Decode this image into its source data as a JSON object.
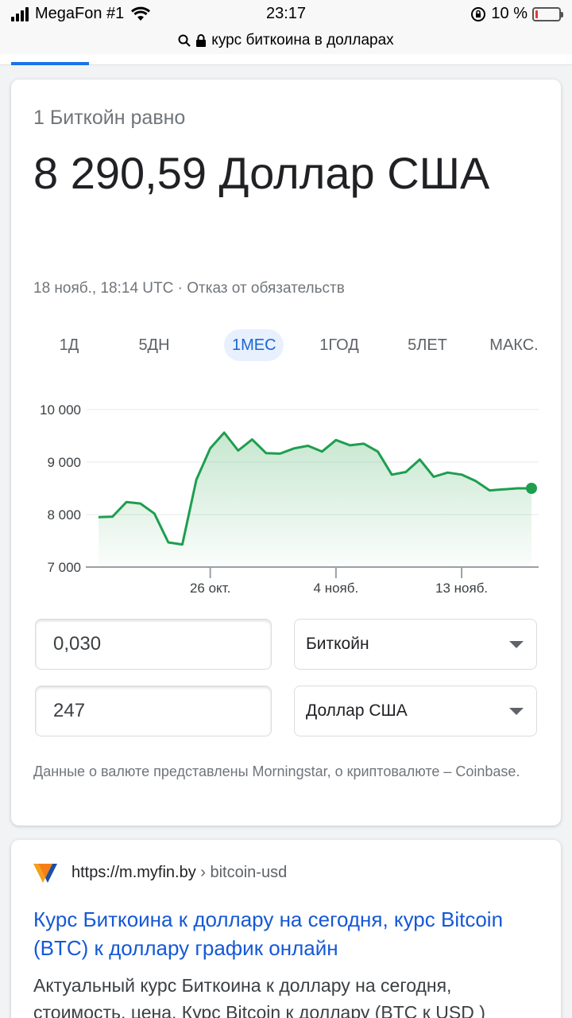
{
  "status_bar": {
    "carrier": "MegaFon #1",
    "time": "23:17",
    "battery_percent": "10 %",
    "battery_level": 0.1
  },
  "url_bar": {
    "text": "курс биткоина в долларах",
    "icons": [
      "search-icon",
      "lock-icon"
    ]
  },
  "converter": {
    "equals_label": "1 Биткойн равно",
    "rate": "8 290,59 Доллар США",
    "meta": "18 нояб., 18:14 UTC · Отказ от обязательств",
    "ranges": [
      "1Д",
      "5ДН",
      "1МЕС",
      "1ГОД",
      "5ЛЕТ",
      "МАКС."
    ],
    "active_range": "1МЕС",
    "from_amount": "0,030",
    "from_currency": "Биткойн",
    "to_amount": "247",
    "to_currency": "Доллар США",
    "source_note": "Данные о валюте представлены Morningstar, о криптовалюте – Coinbase."
  },
  "chart_data": {
    "type": "area",
    "x": [
      "18 окт.",
      "19 окт.",
      "20 окт.",
      "21 окт.",
      "22 окт.",
      "23 окт.",
      "24 окт.",
      "25 окт.",
      "26 окт.",
      "27 окт.",
      "28 окт.",
      "29 окт.",
      "30 окт.",
      "31 окт.",
      "1 нояб.",
      "2 нояб.",
      "3 нояб.",
      "4 нояб.",
      "5 нояб.",
      "6 нояб.",
      "7 нояб.",
      "8 нояб.",
      "9 нояб.",
      "10 нояб.",
      "11 нояб.",
      "12 нояб.",
      "13 нояб.",
      "14 нояб.",
      "15 нояб.",
      "16 нояб.",
      "17 нояб.",
      "18 нояб."
    ],
    "values": [
      7950,
      7960,
      8240,
      8210,
      8020,
      7470,
      7430,
      8660,
      9260,
      9560,
      9220,
      9430,
      9170,
      9160,
      9260,
      9310,
      9200,
      9420,
      9320,
      9350,
      9200,
      8760,
      8810,
      9050,
      8720,
      8800,
      8760,
      8640,
      8460,
      8480,
      8500,
      8500
    ],
    "ylim": [
      7000,
      10000
    ],
    "yticks": [
      "10 000",
      "9 000",
      "8 000",
      "7 000"
    ],
    "ytick_values": [
      10000,
      9000,
      8000,
      7000
    ],
    "xticks": [
      "26 окт.",
      "4 нояб.",
      "13 нояб."
    ],
    "xtick_index": [
      8,
      17,
      26
    ],
    "line_color": "#1e9e4f",
    "fill_color": "#34a853",
    "grid": true
  },
  "result": {
    "url_host": "https://m.myfin.by",
    "url_path": " › bitcoin-usd",
    "title": "Курс Биткоина к доллару на сегодня, курс Bitcoin (BTC) к доллару график онлайн",
    "snippet": "Актуальный курс Биткоина к доллару на сегодня, стоимость, цена. Курс Bitcoin к доллару (BTC к USD )"
  }
}
